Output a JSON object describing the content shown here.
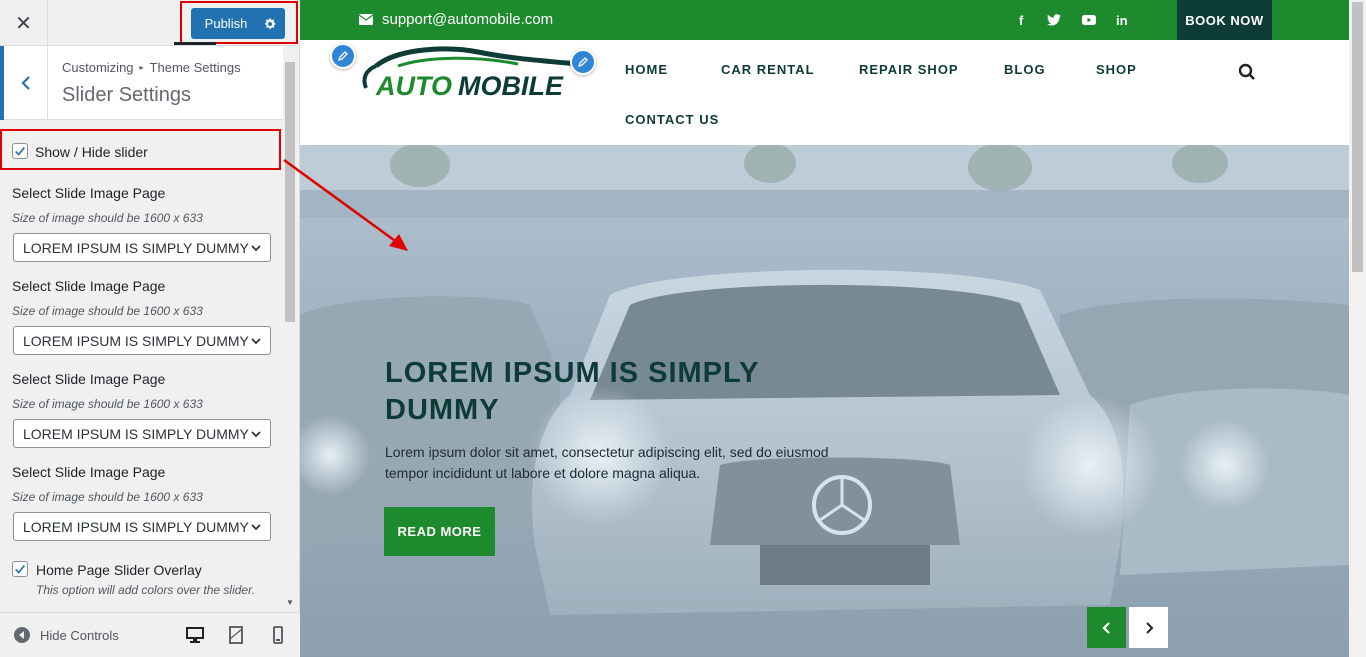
{
  "customizer": {
    "publish_label": "Publish",
    "breadcrumb_root": "Customizing",
    "breadcrumb_parent": "Theme Settings",
    "section_title": "Slider Settings",
    "show_hide_label": "Show / Hide slider",
    "slides": [
      {
        "title": "Select Slide Image Page",
        "desc": "Size of image should be 1600 x 633",
        "value": "LOREM IPSUM IS SIMPLY DUMMY"
      },
      {
        "title": "Select Slide Image Page",
        "desc": "Size of image should be 1600 x 633",
        "value": "LOREM IPSUM IS SIMPLY DUMMY"
      },
      {
        "title": "Select Slide Image Page",
        "desc": "Size of image should be 1600 x 633",
        "value": "LOREM IPSUM IS SIMPLY DUMMY"
      },
      {
        "title": "Select Slide Image Page",
        "desc": "Size of image should be 1600 x 633",
        "value": "LOREM IPSUM IS SIMPLY DUMMY"
      }
    ],
    "overlay_label": "Home Page Slider Overlay",
    "overlay_desc": "This option will add colors over the slider.",
    "hide_controls": "Hide Controls"
  },
  "site": {
    "email": "support@automobile.com",
    "social": [
      "f",
      "twitter",
      "youtube",
      "in"
    ],
    "book_now": "BOOK NOW",
    "logo_text": "AUTO MOBILE",
    "nav": [
      "HOME",
      "CAR RENTAL",
      "REPAIR SHOP",
      "BLOG",
      "SHOP",
      "CONTACT US"
    ],
    "slider": {
      "title": "LOREM IPSUM IS SIMPLY DUMMY",
      "text": "Lorem ipsum dolor sit amet, consectetur adipiscing elit, sed do eiusmod tempor incididunt ut labore et dolore magna aliqua.",
      "button": "READ MORE"
    }
  },
  "colors": {
    "wp_blue": "#2271b1",
    "brand_green": "#1e8a2e",
    "dark_teal": "#0d3b36",
    "annotation_red": "#e10000"
  }
}
